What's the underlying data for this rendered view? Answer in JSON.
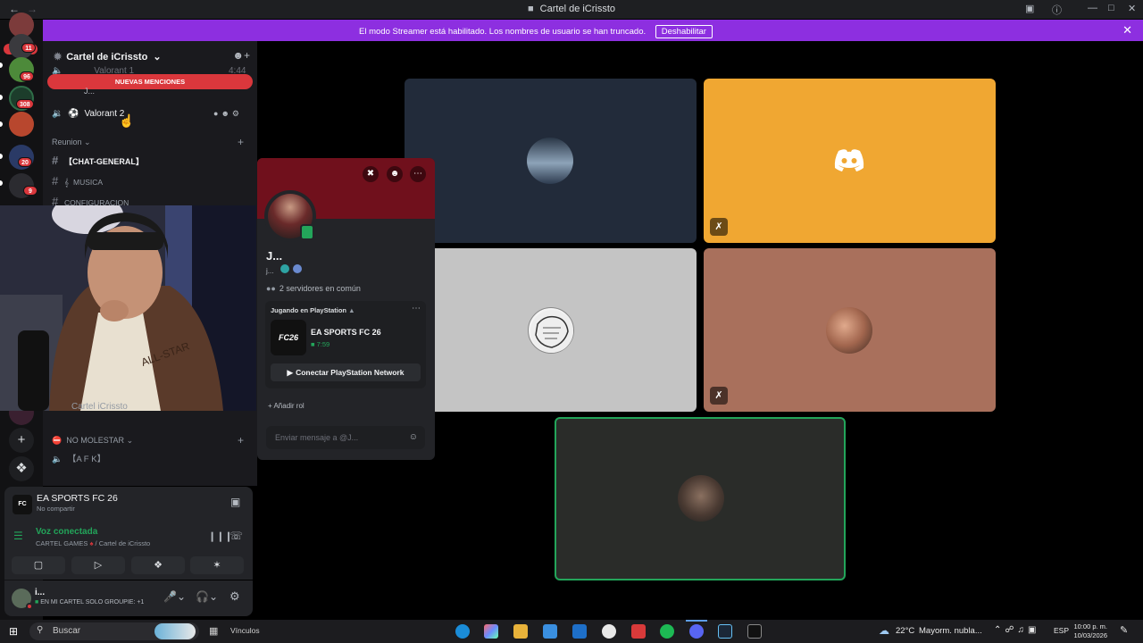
{
  "window": {
    "title": "Cartel de iCrissto",
    "back": "←",
    "forward": "→"
  },
  "banner": {
    "message": "El modo Streamer está habilitado. Los nombres de usuario se han truncado.",
    "button": "Deshabilitar",
    "close": "✕"
  },
  "rail": {
    "nuevo": "NUEVO",
    "badges": [
      "11",
      "96",
      "308",
      "20",
      "9"
    ],
    "icons": [
      "plus-icon",
      "compass-icon"
    ]
  },
  "sidebar": {
    "server_name": "Cartel de iCrissto",
    "mentions": "NUEVAS MENCIONES",
    "voice_top": "Valorant 1",
    "voice_top_time": "4:44",
    "voice_top_member": "J...",
    "voice_active": "Valorant 2",
    "category_reunion": "Reunion",
    "channels": [
      "【CHAT-GENERAL】",
      "MUSICA",
      "CONFIGURACION"
    ],
    "partial_member": "Cartel iCrissto",
    "category_dnd": "NO MOLESTAR",
    "afk": "【A F K】"
  },
  "activity": {
    "game": "EA SPORTS FC 26",
    "status": "No compartir"
  },
  "voice": {
    "status": "Voz conectada",
    "location_server": "CARTEL GAMES",
    "location_channel": "/ Cartel de iCrissto"
  },
  "user": {
    "name": "i...",
    "status": "EN MI CARTEL SOLO GROUPIE: +1"
  },
  "profile": {
    "name": "J...",
    "tag": "j...",
    "servers": "2 servidores en común",
    "playing_header": "Jugando en PlayStation",
    "game": "EA SPORTS FC 26",
    "time": "7:59",
    "connect": "Conectar PlayStation Network",
    "add_role": "Añadir rol",
    "message_placeholder": "Enviar mensaje a @J..."
  },
  "taskbar": {
    "search": "Buscar",
    "vinculos": "Vínculos",
    "weather": "22°C",
    "weather_desc": "Mayorm. nubla...",
    "lang": "ESP",
    "time": "10:00 p. m.",
    "date": "10/03/2026"
  },
  "colors": {
    "brand": "#5865f2",
    "streamer": "#8d2fe0",
    "mention": "#da373c",
    "voice_green": "#23a55a",
    "discord_tile": "#f0a732"
  }
}
